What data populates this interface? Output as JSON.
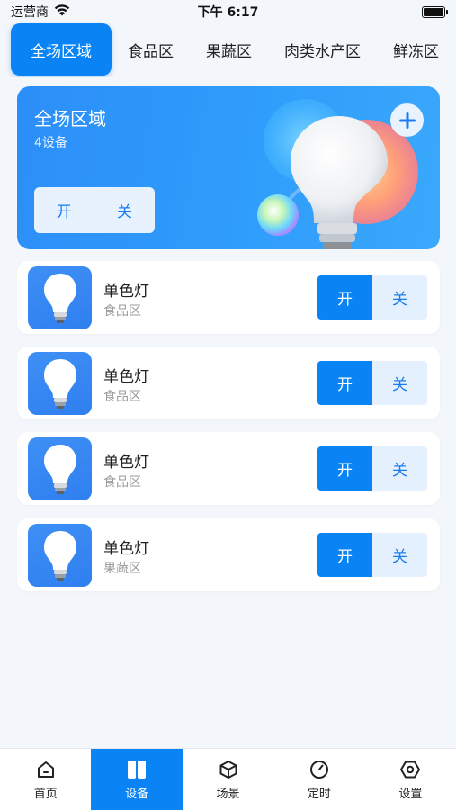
{
  "status_bar": {
    "carrier": "运营商",
    "time": "下午 6:17",
    "icons": [
      "wifi-icon",
      "battery-icon"
    ]
  },
  "tabs": [
    {
      "label": "全场区域",
      "active": true
    },
    {
      "label": "食品区",
      "active": false
    },
    {
      "label": "果蔬区",
      "active": false
    },
    {
      "label": "肉类水产区",
      "active": false
    },
    {
      "label": "鲜冻区",
      "active": false
    }
  ],
  "hero": {
    "title": "全场区域",
    "subtitle": "4设备",
    "on_label": "开",
    "off_label": "关",
    "add_icon": "plus-icon"
  },
  "devices": [
    {
      "name": "单色灯",
      "zone": "食品区",
      "on_label": "开",
      "off_label": "关"
    },
    {
      "name": "单色灯",
      "zone": "食品区",
      "on_label": "开",
      "off_label": "关"
    },
    {
      "name": "单色灯",
      "zone": "食品区",
      "on_label": "开",
      "off_label": "关"
    },
    {
      "name": "单色灯",
      "zone": "果蔬区",
      "on_label": "开",
      "off_label": "关"
    }
  ],
  "bottom_nav": [
    {
      "label": "首页",
      "icon": "home-icon",
      "active": false
    },
    {
      "label": "设备",
      "icon": "devices-icon",
      "active": true
    },
    {
      "label": "场景",
      "icon": "cube-icon",
      "active": false
    },
    {
      "label": "定时",
      "icon": "timer-icon",
      "active": false
    },
    {
      "label": "设置",
      "icon": "settings-icon",
      "active": false
    }
  ],
  "colors": {
    "accent": "#0a84f5",
    "background": "#f3f6fa",
    "off_button_bg": "#e4f0fd"
  }
}
